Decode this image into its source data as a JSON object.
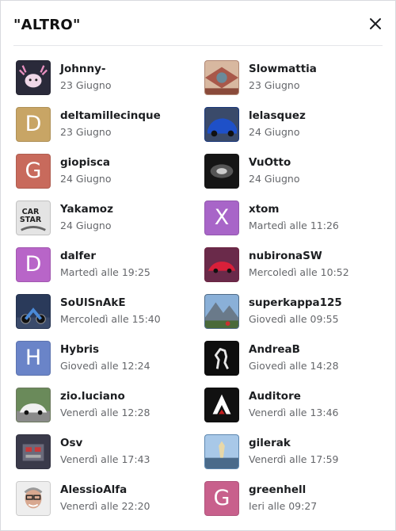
{
  "dialog": {
    "title": "\"ALTRO\""
  },
  "entries": [
    {
      "name": "Johnny-",
      "date": "23 Giugno",
      "letter": "",
      "color": "#2a2a3a",
      "icon": "axolotl-photo"
    },
    {
      "name": "Slowmattia",
      "date": "23 Giugno",
      "letter": "",
      "color": "#c99a84",
      "icon": "pattern-photo"
    },
    {
      "name": "deltamillecinque",
      "date": "23 Giugno",
      "letter": "D",
      "color": "#c8a565",
      "icon": "letter"
    },
    {
      "name": "lelasquez",
      "date": "24 Giugno",
      "letter": "",
      "color": "#1d3f8c",
      "icon": "blue-car-photo"
    },
    {
      "name": "giopisca",
      "date": "24 Giugno",
      "letter": "G",
      "color": "#c86a5c",
      "icon": "letter"
    },
    {
      "name": "VuOtto",
      "date": "24 Giugno",
      "letter": "",
      "color": "#1a1a1a",
      "icon": "grille-photo"
    },
    {
      "name": "Yakamoz",
      "date": "24 Giugno",
      "letter": "",
      "color": "#dcdcdc",
      "icon": "car-star-photo"
    },
    {
      "name": "xtom",
      "date": "Martedì alle 11:26",
      "letter": "X",
      "color": "#a865c8",
      "icon": "letter"
    },
    {
      "name": "dalfer",
      "date": "Martedì alle 19:25",
      "letter": "D",
      "color": "#b865c8",
      "icon": "letter"
    },
    {
      "name": "nubironaSW",
      "date": "Mercoledì alle 10:52",
      "letter": "",
      "color": "#7a2a4a",
      "icon": "red-car-photo"
    },
    {
      "name": "SoUlSnAkE",
      "date": "Mercoledì alle 15:40",
      "letter": "",
      "color": "#2a3a5a",
      "icon": "motorbike-photo"
    },
    {
      "name": "superkappa125",
      "date": "Giovedì alle 09:55",
      "letter": "",
      "color": "#5a7a9a",
      "icon": "mountain-photo"
    },
    {
      "name": "Hybris",
      "date": "Giovedì alle 12:24",
      "letter": "H",
      "color": "#6a84c8",
      "icon": "letter"
    },
    {
      "name": "AndreaB",
      "date": "Giovedì alle 14:28",
      "letter": "",
      "color": "#0e0e0e",
      "icon": "horse-logo"
    },
    {
      "name": "zio.luciano",
      "date": "Venerdì alle 12:28",
      "letter": "",
      "color": "#7a8a6a",
      "icon": "white-car-photo"
    },
    {
      "name": "Auditore",
      "date": "Venerdì alle 13:46",
      "letter": "",
      "color": "#111111",
      "icon": "assassin-logo"
    },
    {
      "name": "Osv",
      "date": "Venerdì alle 17:43",
      "letter": "",
      "color": "#3a3a4a",
      "icon": "engine-photo"
    },
    {
      "name": "gilerak",
      "date": "Venerdì alle 17:59",
      "letter": "",
      "color": "#6a9ac8",
      "icon": "statue-photo"
    },
    {
      "name": "AlessioAlfa",
      "date": "Venerdì alle 22:20",
      "letter": "",
      "color": "#e8e8e8",
      "icon": "portrait-photo"
    },
    {
      "name": "greenhell",
      "date": "Ieri alle 09:27",
      "letter": "G",
      "color": "#c8608c",
      "icon": "letter"
    }
  ]
}
